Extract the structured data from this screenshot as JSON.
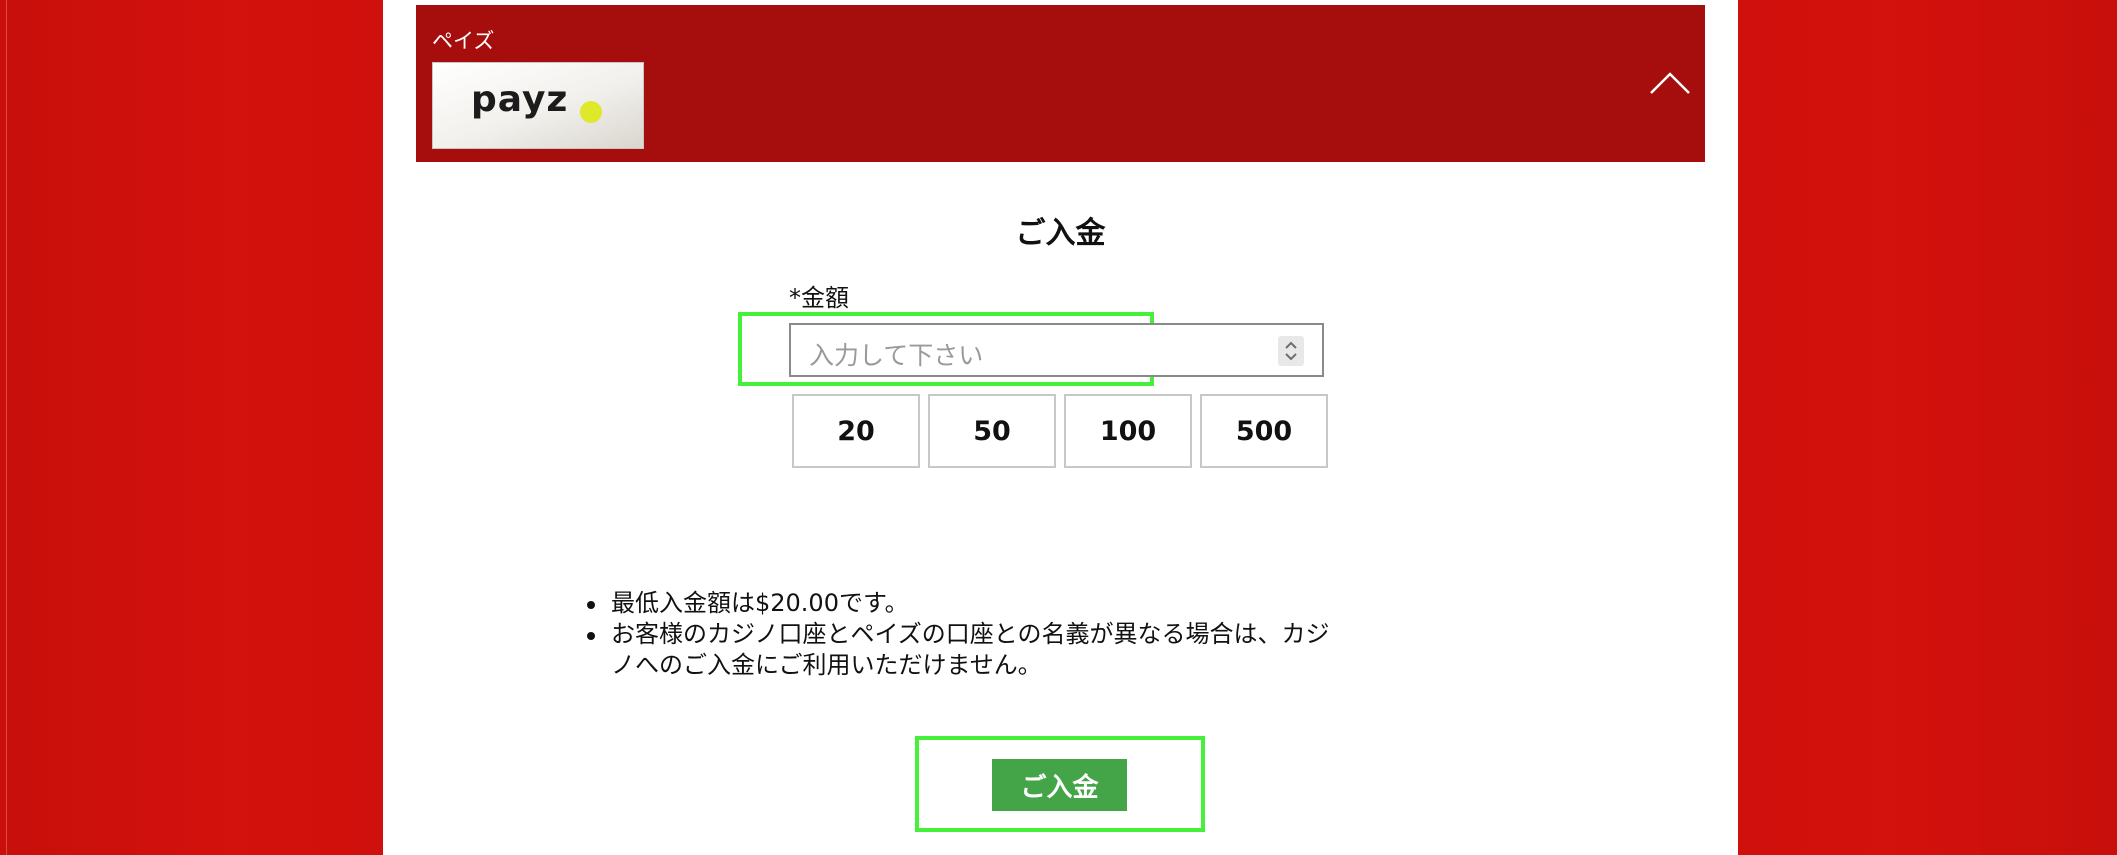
{
  "header": {
    "provider_name": "ペイズ",
    "logo_text": "payz",
    "collapse_icon": "chevron-up-icon"
  },
  "deposit": {
    "title": "ご入金",
    "amount_label": "*金額",
    "amount_placeholder": "入力して下さい",
    "stepper_icon": "spin-stepper-icon",
    "preset_amounts": [
      "20",
      "50",
      "100",
      "500"
    ],
    "notes": [
      "最低入金額は$20.00です。",
      "お客様のカジノ口座とペイズの口座との名義が異なる場合は、カジノへのご入金にご利用いただけません。"
    ],
    "submit_label": "ご入金"
  },
  "colors": {
    "background_red": "#d0100c",
    "header_red": "#a50e0c",
    "submit_green": "#43a548",
    "highlight_green": "#45f03a",
    "logo_dot": "#dfe82a"
  }
}
